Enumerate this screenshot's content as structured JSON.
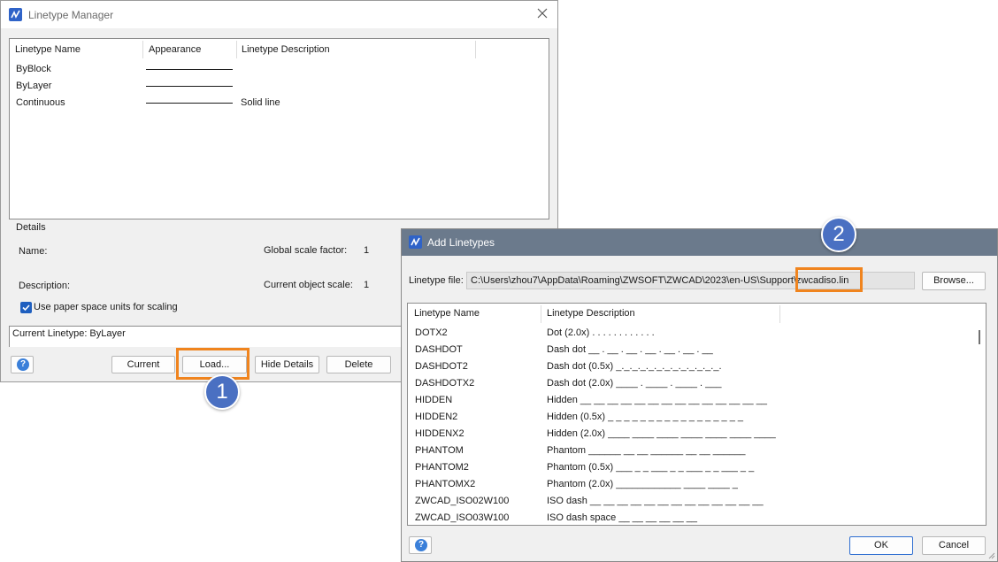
{
  "linetype_manager": {
    "title": "Linetype Manager",
    "columns": [
      "Linetype Name",
      "Appearance",
      "Linetype Description"
    ],
    "rows": [
      {
        "name": "ByBlock",
        "description": ""
      },
      {
        "name": "ByLayer",
        "description": ""
      },
      {
        "name": "Continuous",
        "description": "Solid line"
      }
    ],
    "details_label": "Details",
    "name_label": "Name:",
    "description_label": "Description:",
    "global_scale_label": "Global scale factor:",
    "global_scale_value": "1",
    "object_scale_label": "Current object scale:",
    "object_scale_value": "1",
    "paper_space_label": "Use paper space units for scaling",
    "paper_space_checked": true,
    "current_linetype": "Current Linetype: ByLayer",
    "buttons": {
      "current": "Current",
      "load": "Load...",
      "hide_details": "Hide Details",
      "delete": "Delete"
    }
  },
  "add_linetypes": {
    "title": "Add Linetypes",
    "file_label": "Linetype file:",
    "file_path": "C:\\Users\\zhou7\\AppData\\Roaming\\ZWSOFT\\ZWCAD\\2023\\en-US\\Support\\zwcadiso.lin",
    "browse": "Browse...",
    "columns": [
      "Linetype Name",
      "Linetype Description"
    ],
    "rows": [
      {
        "name": "DOTX2",
        "description": "Dot (2.0x) .  .  .  .  .  .  .  .  .  .  .  ."
      },
      {
        "name": "DASHDOT",
        "description": "Dash dot __ . __ . __ . __ . __ . __ . __"
      },
      {
        "name": "DASHDOT2",
        "description": "Dash dot (0.5x) _._._._._._._._._._._._._."
      },
      {
        "name": "DASHDOTX2",
        "description": "Dash dot (2.0x) ____  .  ____  .  ____  .  ___"
      },
      {
        "name": "HIDDEN",
        "description": "Hidden __ __ __ __ __ __ __ __ __ __ __ __ __ __"
      },
      {
        "name": "HIDDEN2",
        "description": "Hidden (0.5x) _ _ _ _ _ _ _ _ _ _ _ _ _ _ _ _ _"
      },
      {
        "name": "HIDDENX2",
        "description": "Hidden (2.0x) ____ ____ ____ ____ ____ ____ ____"
      },
      {
        "name": "PHANTOM",
        "description": "Phantom ______  __  __  ______  __  __  ______"
      },
      {
        "name": "PHANTOM2",
        "description": "Phantom (0.5x) ___ _ _ ___ _ _ ___ _ _ ___ _ _"
      },
      {
        "name": "PHANTOMX2",
        "description": "Phantom (2.0x) ____________    ____    ____   _"
      },
      {
        "name": "ZWCAD_ISO02W100",
        "description": "ISO dash __ __ __ __ __ __ __ __ __ __ __ __ __"
      },
      {
        "name": "ZWCAD_ISO03W100",
        "description": "ISO dash space __    __    __    __    __    __"
      }
    ],
    "buttons": {
      "ok": "OK",
      "cancel": "Cancel"
    }
  },
  "annotations": {
    "step1": "1",
    "step2": "2",
    "highlight_color": "#f0841e",
    "badge_color": "#4a70c2"
  }
}
